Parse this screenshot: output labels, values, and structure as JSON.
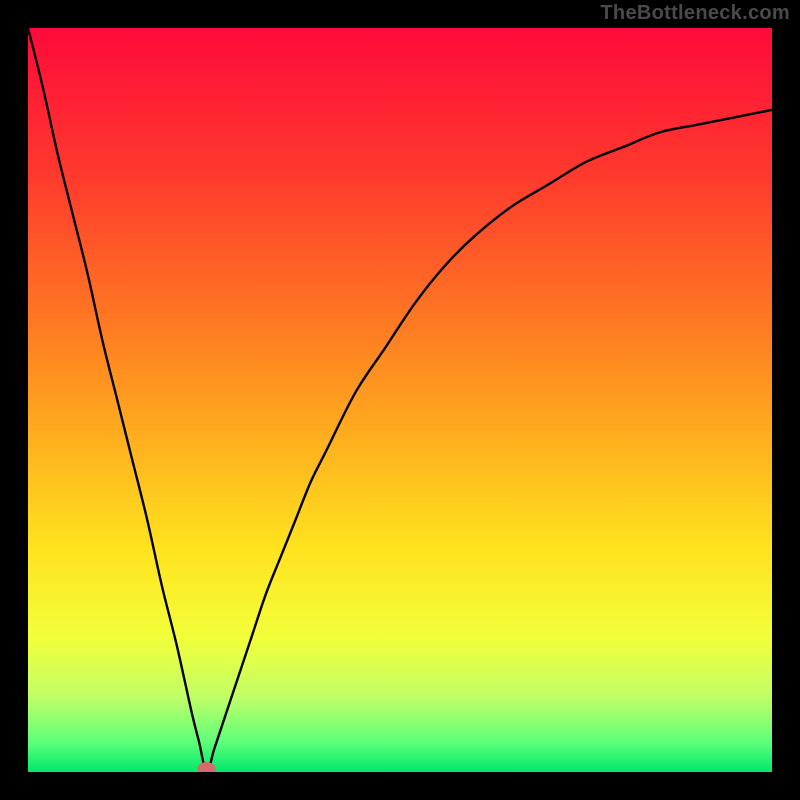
{
  "watermark": "TheBottleneck.com",
  "chart_data": {
    "type": "line",
    "title": "",
    "xlabel": "",
    "ylabel": "",
    "x_range": [
      0,
      100
    ],
    "y_range": [
      0,
      100
    ],
    "min_point": {
      "x": 24,
      "y": 0
    },
    "series": [
      {
        "name": "bottleneck-curve",
        "x": [
          0,
          2,
          4,
          6,
          8,
          10,
          12,
          14,
          16,
          18,
          20,
          22,
          23,
          24,
          25,
          26,
          28,
          30,
          32,
          34,
          36,
          38,
          40,
          44,
          48,
          52,
          56,
          60,
          65,
          70,
          75,
          80,
          85,
          90,
          95,
          100
        ],
        "y": [
          100,
          92,
          83,
          75,
          67,
          58,
          50,
          42,
          34,
          25,
          17,
          8,
          4,
          0,
          3,
          6,
          12,
          18,
          24,
          29,
          34,
          39,
          43,
          51,
          57,
          63,
          68,
          72,
          76,
          79,
          82,
          84,
          86,
          87,
          88,
          89
        ]
      }
    ],
    "marker": {
      "x": 24,
      "y": 0,
      "color": "#d46a6a"
    },
    "background_gradient": {
      "stops": [
        {
          "offset": 0.0,
          "color": "#ff0a3a"
        },
        {
          "offset": 0.2,
          "color": "#ff3a2d"
        },
        {
          "offset": 0.4,
          "color": "#ff7a22"
        },
        {
          "offset": 0.55,
          "color": "#ffae1e"
        },
        {
          "offset": 0.7,
          "color": "#ffe31e"
        },
        {
          "offset": 0.82,
          "color": "#f2ff3a"
        },
        {
          "offset": 0.9,
          "color": "#bfff66"
        },
        {
          "offset": 0.96,
          "color": "#5eff7a"
        },
        {
          "offset": 1.0,
          "color": "#00e86b"
        }
      ]
    }
  }
}
